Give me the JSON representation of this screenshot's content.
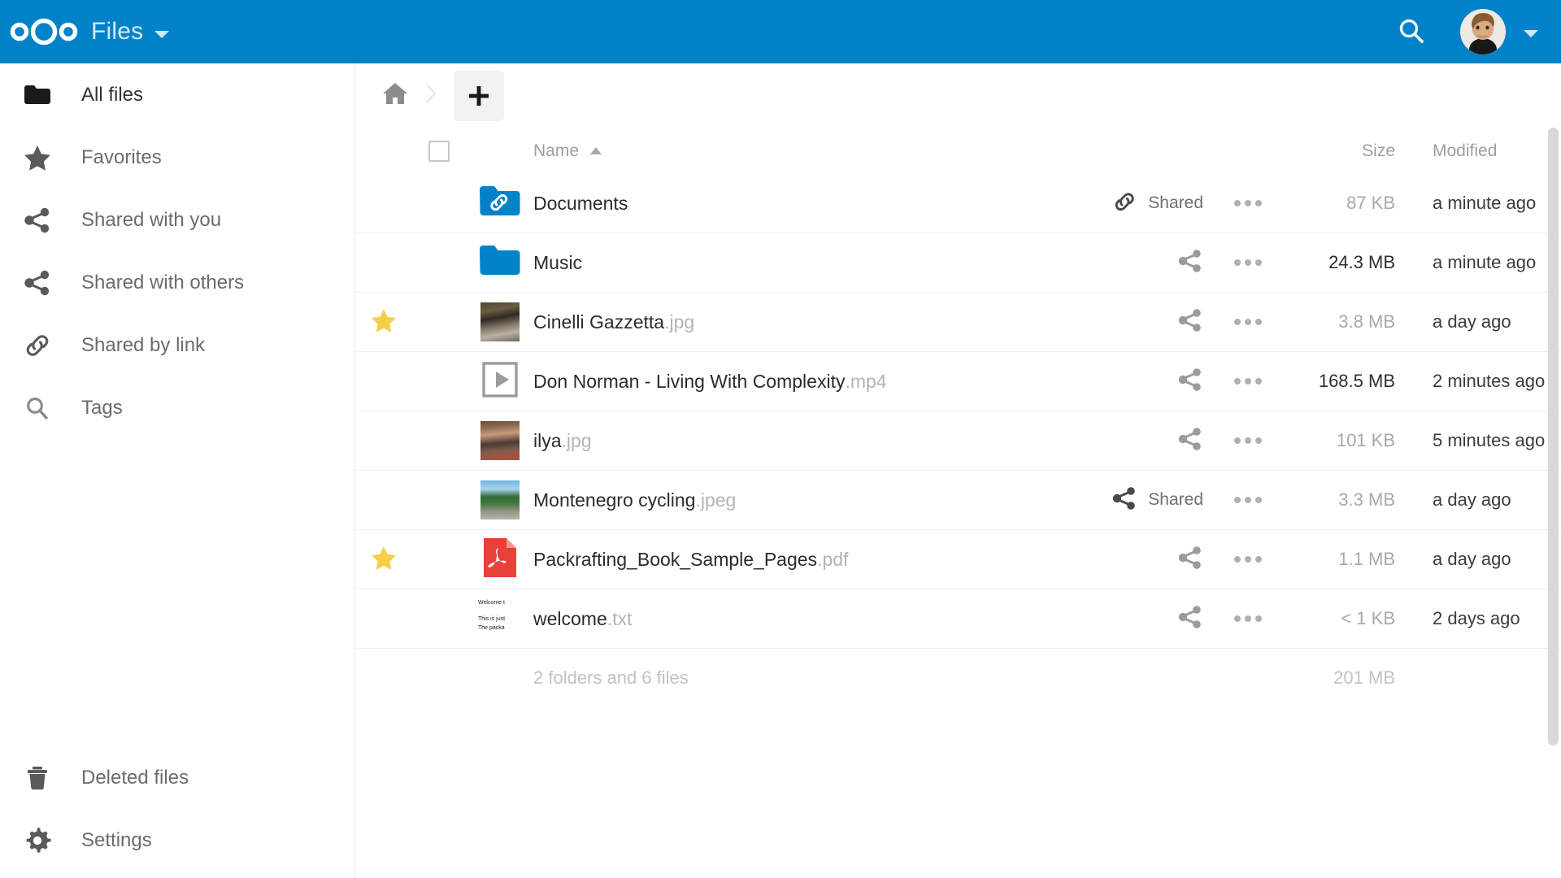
{
  "header": {
    "logo_name": "nextcloud-logo",
    "app_title": "Files",
    "app_caret": "chevron-down-icon",
    "search_icon": "search-icon",
    "avatar": "user-avatar",
    "user_caret": "chevron-down-icon",
    "brand_color": "#0082c9"
  },
  "sidebar": {
    "items": [
      {
        "label": "All files",
        "icon": "folder-icon",
        "active": true
      },
      {
        "label": "Favorites",
        "icon": "star-icon",
        "active": false
      },
      {
        "label": "Shared with you",
        "icon": "share-nodes-icon",
        "active": false
      },
      {
        "label": "Shared with others",
        "icon": "share-nodes-icon",
        "active": false
      },
      {
        "label": "Shared by link",
        "icon": "link-icon",
        "active": false
      },
      {
        "label": "Tags",
        "icon": "search-icon",
        "active": false
      }
    ],
    "bottom_items": [
      {
        "label": "Deleted files",
        "icon": "trash-icon"
      },
      {
        "label": "Settings",
        "icon": "gear-icon"
      }
    ]
  },
  "controls": {
    "home_crumb": "home-icon",
    "crumb_separator": "chevron-right-icon",
    "new_button_label": "+",
    "new_button_name": "new-file-button"
  },
  "table": {
    "select_all": "select-all-checkbox",
    "columns": {
      "name": "Name",
      "size": "Size",
      "modified": "Modified"
    },
    "sort": {
      "column": "Name",
      "direction": "ascending",
      "icon": "sort-asc-icon"
    },
    "rows": [
      {
        "name": "Documents",
        "ext": "",
        "icon": "folder-shared-link-icon",
        "favorite": false,
        "share": {
          "type": "link",
          "icon": "link-icon",
          "label": "Shared"
        },
        "size": "87 KB",
        "size_dim": true,
        "modified": "a minute ago"
      },
      {
        "name": "Music",
        "ext": "",
        "icon": "folder-icon",
        "favorite": false,
        "share": {
          "type": "none",
          "icon": "share-nodes-icon",
          "label": ""
        },
        "size": "24.3 MB",
        "size_dim": false,
        "modified": "a minute ago"
      },
      {
        "name": "Cinelli Gazzetta",
        "ext": ".jpg",
        "icon": "image-thumbnail",
        "favorite": true,
        "share": {
          "type": "none",
          "icon": "share-nodes-icon",
          "label": ""
        },
        "size": "3.8 MB",
        "size_dim": true,
        "modified": "a day ago"
      },
      {
        "name": "Don Norman - Living With Complexity",
        "ext": ".mp4",
        "icon": "video-play-icon",
        "favorite": false,
        "share": {
          "type": "none",
          "icon": "share-nodes-icon",
          "label": ""
        },
        "size": "168.5 MB",
        "size_dim": false,
        "modified": "2 minutes ago"
      },
      {
        "name": "ilya",
        "ext": ".jpg",
        "icon": "image-thumbnail",
        "favorite": false,
        "share": {
          "type": "none",
          "icon": "share-nodes-icon",
          "label": ""
        },
        "size": "101 KB",
        "size_dim": true,
        "modified": "5 minutes ago"
      },
      {
        "name": "Montenegro cycling",
        "ext": ".jpeg",
        "icon": "image-thumbnail",
        "favorite": false,
        "share": {
          "type": "users",
          "icon": "share-nodes-icon",
          "label": "Shared"
        },
        "size": "3.3 MB",
        "size_dim": true,
        "modified": "a day ago"
      },
      {
        "name": "Packrafting_Book_Sample_Pages",
        "ext": ".pdf",
        "icon": "pdf-icon",
        "favorite": true,
        "share": {
          "type": "none",
          "icon": "share-nodes-icon",
          "label": ""
        },
        "size": "1.1 MB",
        "size_dim": true,
        "modified": "a day ago"
      },
      {
        "name": "welcome",
        "ext": ".txt",
        "icon": "text-thumbnail",
        "favorite": false,
        "share": {
          "type": "none",
          "icon": "share-nodes-icon",
          "label": ""
        },
        "size": "< 1 KB",
        "size_dim": true,
        "modified": "2 days ago",
        "thumb_text": {
          "line1": "Welcome t",
          "line2": "This is just",
          "line3": "The packa"
        }
      }
    ],
    "footer": {
      "summary": "2 folders and 6 files",
      "total_size": "201 MB"
    }
  }
}
